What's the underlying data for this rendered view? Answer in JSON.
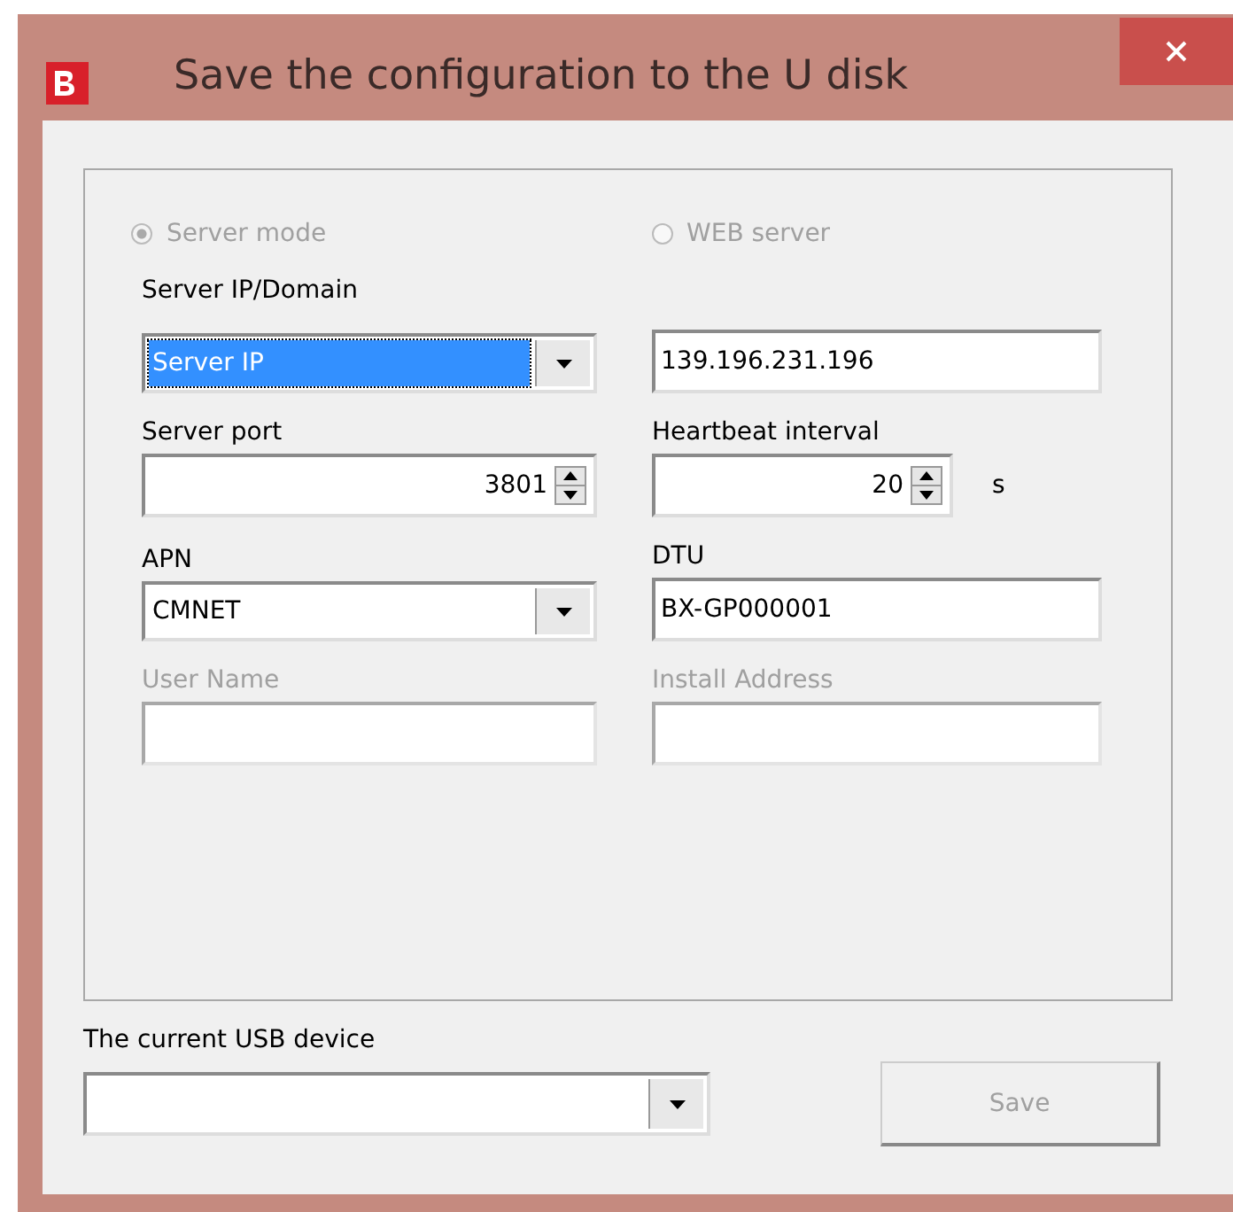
{
  "window": {
    "title": "Save the configuration to the U disk"
  },
  "mode_options": [
    {
      "label": "Server mode",
      "selected": true,
      "disabled": true
    },
    {
      "label": "WEB server",
      "selected": false,
      "disabled": true
    }
  ],
  "fields": [
    {
      "kind": "combo",
      "label": "Server IP/Domain",
      "value": "Server IP",
      "highlighted": true,
      "disabled": false
    },
    {
      "kind": "text",
      "value": "139.196.231.196",
      "disabled": false
    },
    {
      "kind": "spin",
      "label": "Server port",
      "value": "3801",
      "disabled": false
    },
    {
      "kind": "spin",
      "label": "Heartbeat interval",
      "value": "20",
      "unit": "s",
      "disabled": false
    },
    {
      "kind": "combo",
      "label": "APN",
      "value": "CMNET",
      "highlighted": false,
      "disabled": false
    },
    {
      "kind": "text",
      "label": "DTU",
      "value": "BX-GP000001",
      "disabled": false
    },
    {
      "kind": "text",
      "label": "User Name",
      "disabled": true
    },
    {
      "kind": "text",
      "label": "Install Address",
      "disabled": true
    }
  ],
  "usb_device": {
    "label": "The current USB device"
  },
  "save_button": {
    "label": "Save",
    "disabled": true
  }
}
